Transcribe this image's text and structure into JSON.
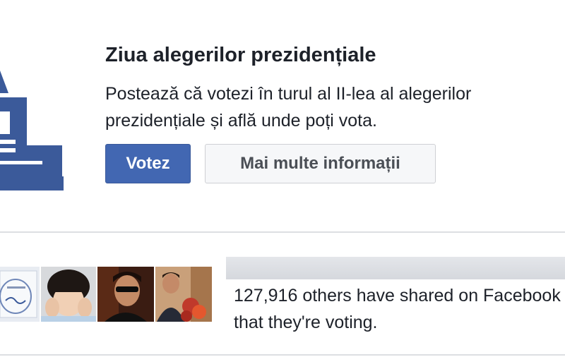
{
  "card": {
    "title": "Ziua alegerilor prezidențiale",
    "description": "Postează că votezi în turul al II-lea al alegerilor prezidențiale și află unde poți vota.",
    "primary_button": "Votez",
    "secondary_button": "Mai multe informații",
    "accent_color": "#4267b2",
    "icon": "ballot-box-icon"
  },
  "social": {
    "avatars": [
      "voting-paper-photo",
      "child-photo",
      "man-sunglasses-photo",
      "man-flowers-photo"
    ],
    "shared_text": "127,916 others have shared on Facebook that they're voting."
  }
}
